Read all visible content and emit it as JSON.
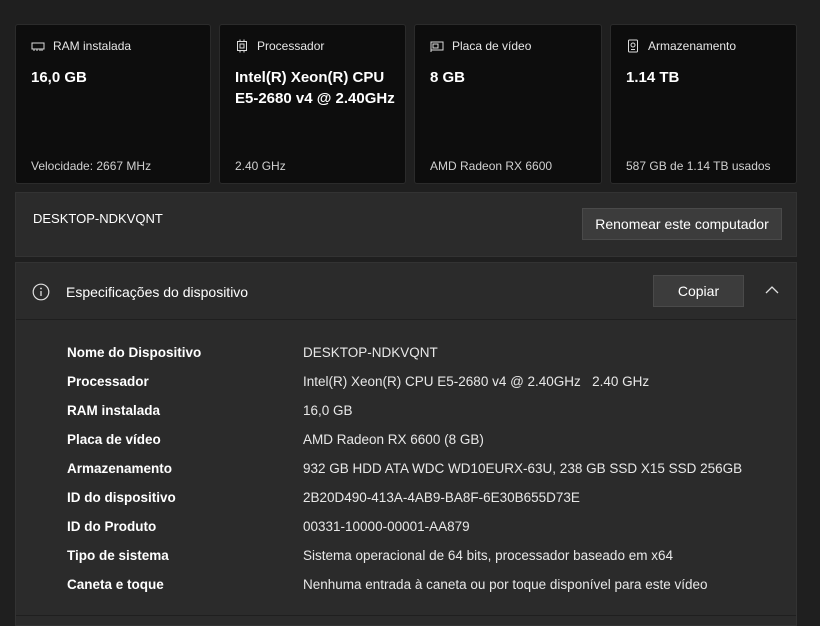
{
  "cards": [
    {
      "icon": "ram-icon",
      "title": "RAM instalada",
      "value": "16,0 GB",
      "footer": "Velocidade: 2667 MHz"
    },
    {
      "icon": "processor-icon",
      "title": "Processador",
      "value": "Intel(R) Xeon(R) CPU E5-2680 v4 @ 2.40GHz",
      "footer": "2.40 GHz"
    },
    {
      "icon": "gpu-icon",
      "title": "Placa de vídeo",
      "value": "8 GB",
      "footer": "AMD Radeon RX 6600"
    },
    {
      "icon": "storage-icon",
      "title": "Armazenamento",
      "value": "1.14 TB",
      "footer": "587 GB de 1.14 TB usados"
    }
  ],
  "computer": {
    "name": "DESKTOP-NDKVQNT",
    "rename_label": "Renomear este computador"
  },
  "specs": {
    "title": "Especificações do dispositivo",
    "copy_label": "Copiar",
    "rows": [
      {
        "label": "Nome do Dispositivo",
        "value": "DESKTOP-NDKVQNT"
      },
      {
        "label": "Processador",
        "value": "Intel(R) Xeon(R) CPU E5-2680 v4 @ 2.40GHz   2.40 GHz"
      },
      {
        "label": "RAM instalada",
        "value": "16,0 GB"
      },
      {
        "label": "Placa de vídeo",
        "value": "AMD Radeon RX 6600 (8 GB)"
      },
      {
        "label": "Armazenamento",
        "value": "932 GB HDD ATA WDC WD10EURX-63U, 238 GB SSD X15 SSD 256GB"
      },
      {
        "label": "ID do dispositivo",
        "value": "2B20D490-413A-4AB9-BA8F-6E30B655D73E"
      },
      {
        "label": "ID do Produto",
        "value": "00331-10000-00001-AA879"
      },
      {
        "label": "Tipo de sistema",
        "value": "Sistema operacional de 64 bits, processador baseado em x64"
      },
      {
        "label": "Caneta e toque",
        "value": "Nenhuma entrada à caneta ou por toque disponível para este vídeo"
      }
    ]
  }
}
